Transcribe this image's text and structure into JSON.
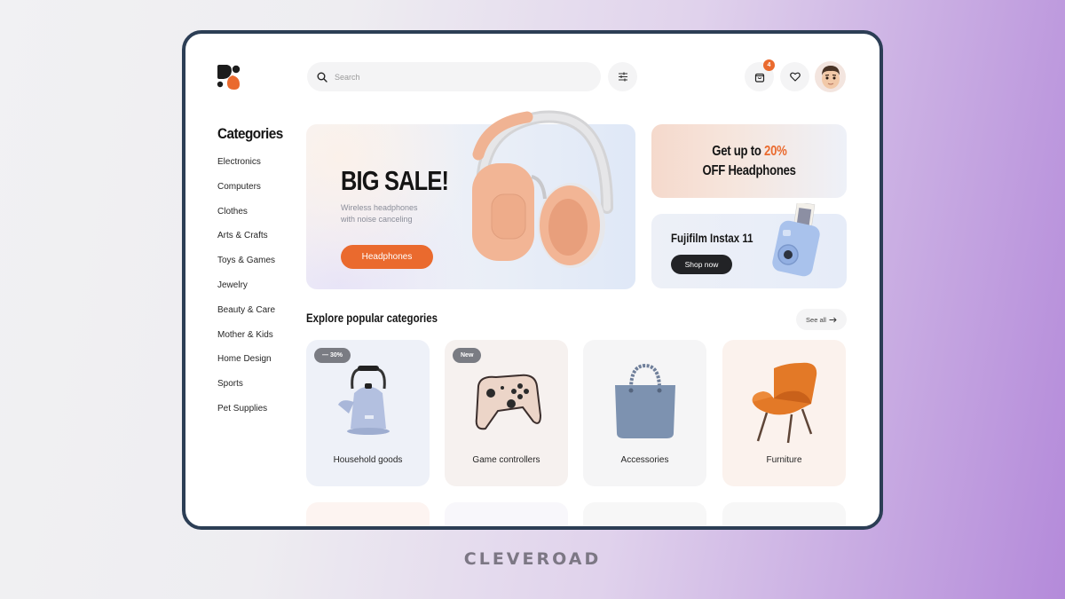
{
  "header": {
    "search_placeholder": "Search",
    "cart_count": "4"
  },
  "sidebar": {
    "title": "Categories",
    "items": [
      {
        "label": "Electronics"
      },
      {
        "label": "Computers"
      },
      {
        "label": "Clothes"
      },
      {
        "label": "Arts & Crafts"
      },
      {
        "label": "Toys & Games"
      },
      {
        "label": "Jewelry"
      },
      {
        "label": "Beauty & Care"
      },
      {
        "label": "Mother & Kids"
      },
      {
        "label": "Home Design"
      },
      {
        "label": "Sports"
      },
      {
        "label": "Pet Supplies"
      }
    ]
  },
  "hero": {
    "title": "BIG SALE!",
    "subtitle_line1": "Wireless headphones",
    "subtitle_line2": "with noise canceling",
    "button": "Headphones"
  },
  "promo_discount": {
    "line1_prefix": "Get up to ",
    "line1_accent": "20%",
    "line2": "OFF Headphones"
  },
  "promo_product": {
    "title": "Fujifilm Instax 11",
    "button": "Shop now"
  },
  "popular": {
    "title": "Explore popular categories",
    "see_all": "See all",
    "cards": [
      {
        "label": "Household goods",
        "tag": "— 30%"
      },
      {
        "label": "Game controllers",
        "tag": "New"
      },
      {
        "label": "Accessories"
      },
      {
        "label": "Furniture"
      }
    ]
  },
  "footer_brand": "CLEVEROAD",
  "colors": {
    "accent": "#ea6a2e",
    "frame": "#2c3e55",
    "dark_button": "#222326"
  }
}
